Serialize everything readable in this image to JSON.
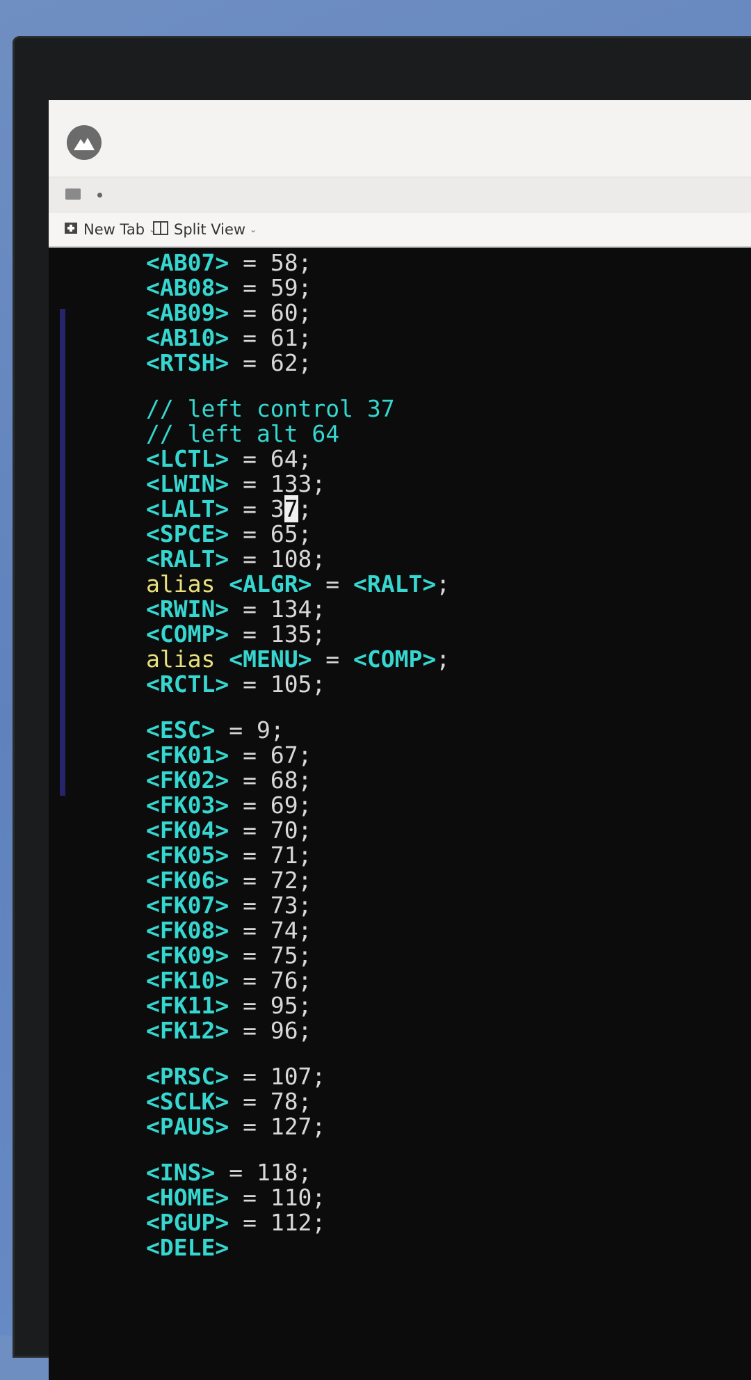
{
  "toolbar": {
    "new_tab_label": "New Tab",
    "split_view_label": "Split View"
  },
  "code_lines": [
    {
      "key": "<AB07>",
      "rest": " = 58;"
    },
    {
      "key": "<AB08>",
      "rest": " = 59;"
    },
    {
      "key": "<AB09>",
      "rest": " = 60;"
    },
    {
      "key": "<AB10>",
      "rest": " = 61;"
    },
    {
      "key": "<RTSH>",
      "rest": " = 62;"
    },
    {
      "blank": true
    },
    {
      "comment": "// left control 37"
    },
    {
      "comment": "// left alt 64"
    },
    {
      "key": "<LCTL>",
      "rest": " = 64;"
    },
    {
      "key": "<LWIN>",
      "rest": " = 133;"
    },
    {
      "key": "<LALT>",
      "rest_pre": " = 3",
      "cursor_char": "7",
      "rest_post": ";"
    },
    {
      "key": "<SPCE>",
      "rest": " = 65;"
    },
    {
      "key": "<RALT>",
      "rest": " = 108;"
    },
    {
      "alias": "alias",
      "key": "<ALGR>",
      "rest": " = ",
      "key2": "<RALT>",
      "tail": ";"
    },
    {
      "key": "<RWIN>",
      "rest": " = 134;"
    },
    {
      "key": "<COMP>",
      "rest": " = 135;"
    },
    {
      "alias": "alias",
      "key": "<MENU>",
      "rest": " = ",
      "key2": "<COMP>",
      "tail": ";"
    },
    {
      "key": "<RCTL>",
      "rest": " = 105;"
    },
    {
      "blank": true
    },
    {
      "key": "<ESC>",
      "rest": " = 9;"
    },
    {
      "key": "<FK01>",
      "rest": " = 67;"
    },
    {
      "key": "<FK02>",
      "rest": " = 68;"
    },
    {
      "key": "<FK03>",
      "rest": " = 69;"
    },
    {
      "key": "<FK04>",
      "rest": " = 70;"
    },
    {
      "key": "<FK05>",
      "rest": " = 71;"
    },
    {
      "key": "<FK06>",
      "rest": " = 72;"
    },
    {
      "key": "<FK07>",
      "rest": " = 73;"
    },
    {
      "key": "<FK08>",
      "rest": " = 74;"
    },
    {
      "key": "<FK09>",
      "rest": " = 75;"
    },
    {
      "key": "<FK10>",
      "rest": " = 76;"
    },
    {
      "key": "<FK11>",
      "rest": " = 95;"
    },
    {
      "key": "<FK12>",
      "rest": " = 96;"
    },
    {
      "blank": true
    },
    {
      "key": "<PRSC>",
      "rest": " = 107;"
    },
    {
      "key": "<SCLK>",
      "rest": " = 78;"
    },
    {
      "key": "<PAUS>",
      "rest": " = 127;"
    },
    {
      "blank": true
    },
    {
      "key": "<INS>",
      "rest": " = 118;"
    },
    {
      "key": "<HOME>",
      "rest": " = 110;"
    },
    {
      "key": "<PGUP>",
      "rest": " = 112;"
    },
    {
      "key": "<DELE>",
      "rest": ""
    }
  ],
  "colors": {
    "key": "#35d7d0",
    "alias": "#e9e17c",
    "text": "#d8d8d8",
    "background": "#0c0c0c"
  },
  "icons": [
    "app-logo-icon",
    "terminal-icon",
    "new-tab-icon",
    "split-view-icon"
  ]
}
